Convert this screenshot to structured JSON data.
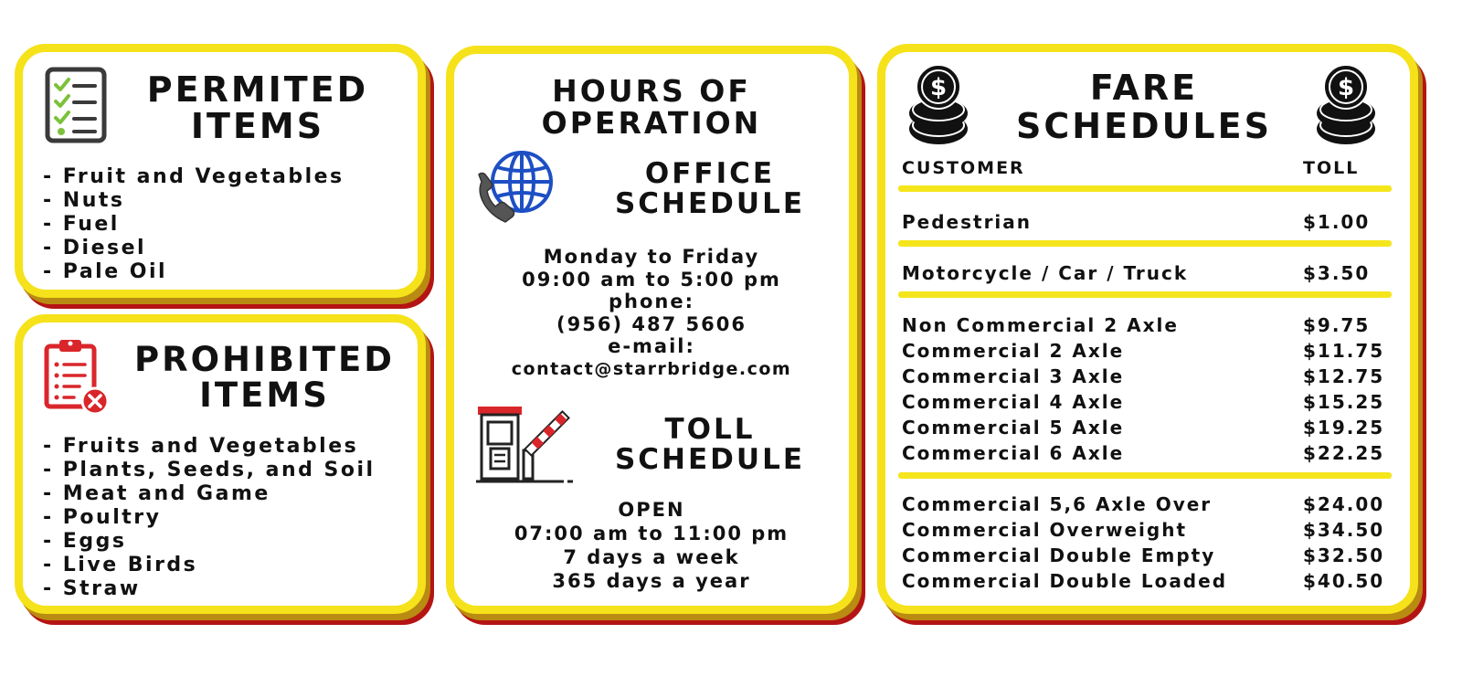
{
  "permitted": {
    "title_line1": "PERMITED",
    "title_line2": "ITEMS",
    "icon": "checklist-icon",
    "items": [
      "- Fruit and Vegetables",
      "- Nuts",
      "- Fuel",
      "- Diesel",
      "- Pale Oil"
    ]
  },
  "prohibited": {
    "title_line1": "PROHIBITED",
    "title_line2": "ITEMS",
    "icon": "prohibited-clipboard-icon",
    "items": [
      "- Fruits and Vegetables",
      "- Plants, Seeds, and Soil",
      "- Meat and Game",
      "- Poultry",
      "- Eggs",
      "- Live Birds",
      "- Straw"
    ]
  },
  "hours": {
    "title_line1": "HOURS OF",
    "title_line2": "OPERATION",
    "office": {
      "icon": "phone-globe-icon",
      "title_line1": "OFFICE",
      "title_line2": "SCHEDULE",
      "lines": [
        "Monday to Friday",
        "09:00 am to 5:00 pm",
        "phone:",
        "(956) 487 5606",
        "e-mail:",
        "contact@starrbridge.com"
      ]
    },
    "toll": {
      "icon": "toll-booth-icon",
      "title_line1": "TOLL",
      "title_line2": "SCHEDULE",
      "lines": [
        "OPEN",
        "07:00 am to 11:00 pm",
        "7 days a week",
        "365 days a year"
      ]
    }
  },
  "fares": {
    "title_line1": "FARE",
    "title_line2": "SCHEDULES",
    "icon": "coin-stack-icon",
    "header_customer": "CUSTOMER",
    "header_toll": "TOLL",
    "rows": [
      {
        "name": "Pedestrian",
        "toll": "$1.00"
      },
      {
        "name": "Motorcycle / Car / Truck",
        "toll": "$3.50"
      },
      {
        "name": "Non Commercial 2 Axle",
        "toll": "$9.75"
      },
      {
        "name": "Commercial 2 Axle",
        "toll": "$11.75"
      },
      {
        "name": "Commercial 3 Axle",
        "toll": "$12.75"
      },
      {
        "name": "Commercial 4 Axle",
        "toll": "$15.25"
      },
      {
        "name": "Commercial 5 Axle",
        "toll": "$19.25"
      },
      {
        "name": "Commercial 6 Axle",
        "toll": "$22.25"
      },
      {
        "name": "Commercial 5,6 Axle Over",
        "toll": "$24.00"
      },
      {
        "name": "Commercial Overweight",
        "toll": "$34.50"
      },
      {
        "name": "Commercial Double Empty",
        "toll": "$32.50"
      },
      {
        "name": "Commercial Double Loaded",
        "toll": "$40.50"
      }
    ]
  },
  "colors": {
    "border_yellow": "#f5e21a",
    "shadow_gold": "#b98b12",
    "shadow_red": "#b51414",
    "check_green": "#7cc13a",
    "globe_blue": "#1d4fc4",
    "alert_red": "#d9262b"
  }
}
